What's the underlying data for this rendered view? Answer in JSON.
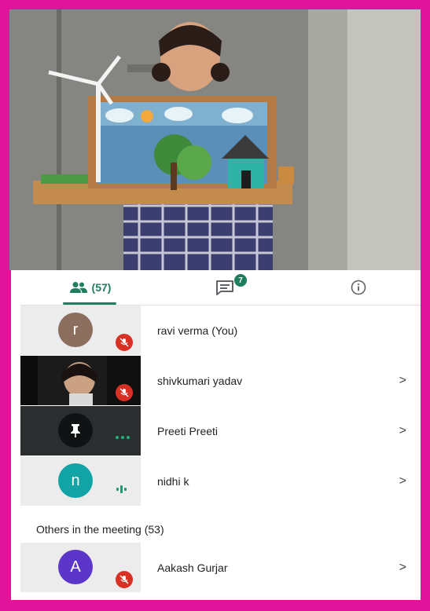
{
  "colors": {
    "frame": "#e0139b",
    "accent": "#1e7c5f",
    "mute": "#d93025"
  },
  "tabs": {
    "people_label": "(57)",
    "chat_badge": "7"
  },
  "participants": [
    {
      "name": "ravi verma (You)",
      "initial": "r",
      "avatar_color": "#8c6e5f",
      "status": "muted"
    },
    {
      "name": "shivkumari yadav",
      "status": "muted",
      "video": true
    },
    {
      "name": "Preeti Preeti",
      "status": "pinned"
    },
    {
      "name": "nidhi k",
      "initial": "n",
      "avatar_color": "#12a4a4",
      "status": "speaking"
    }
  ],
  "others": {
    "label": "Others in the meeting (53)",
    "participants": [
      {
        "name": "Aakash Gurjar",
        "initial": "A",
        "avatar_color": "#5c35c9",
        "status": "muted"
      }
    ]
  },
  "chevron": ">"
}
